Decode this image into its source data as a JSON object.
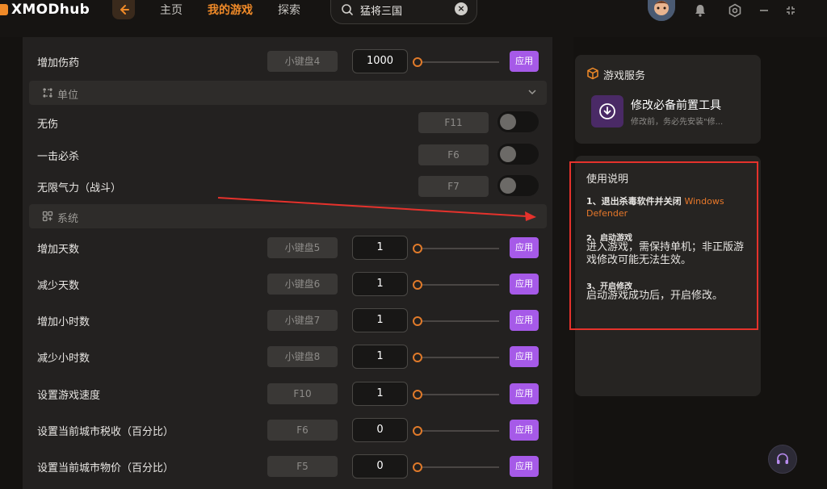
{
  "app": {
    "name": "XMODhub"
  },
  "nav": {
    "home": "主页",
    "my_games": "我的游戏",
    "explore": "探索"
  },
  "search": {
    "value": "猛将三国"
  },
  "colors": {
    "accent": "#f08a28",
    "apply": "#a65ae8",
    "annotation": "#e5322c"
  },
  "mods": {
    "top_row": {
      "label": "增加伤药",
      "key": "小键盘4",
      "value": "1000",
      "apply": "应用"
    },
    "section_unit": {
      "label": "单位"
    },
    "unit_rows": [
      {
        "label": "无伤",
        "key": "F11"
      },
      {
        "label": "一击必杀",
        "key": "F6"
      },
      {
        "label": "无限气力（战斗）",
        "key": "F7"
      }
    ],
    "section_system": {
      "label": "系统"
    },
    "system_rows": [
      {
        "label": "增加天数",
        "key": "小键盘5",
        "value": "1",
        "apply": "应用"
      },
      {
        "label": "减少天数",
        "key": "小键盘6",
        "value": "1",
        "apply": "应用"
      },
      {
        "label": "增加小时数",
        "key": "小键盘7",
        "value": "1",
        "apply": "应用"
      },
      {
        "label": "减少小时数",
        "key": "小键盘8",
        "value": "1",
        "apply": "应用"
      },
      {
        "label": "设置游戏速度",
        "key": "F10",
        "value": "1",
        "apply": "应用"
      },
      {
        "label": "设置当前城市税收（百分比）",
        "key": "F6",
        "value": "0",
        "apply": "应用"
      },
      {
        "label": "设置当前城市物价（百分比）",
        "key": "F5",
        "value": "0",
        "apply": "应用"
      }
    ]
  },
  "service": {
    "title": "游戏服务",
    "tool_name": "修改必备前置工具",
    "tool_desc": "修改前，务必先安装\"修..."
  },
  "usage": {
    "title": "使用说明",
    "step1_prefix": "1、退出杀毒软件并关闭 ",
    "step1_highlight": "Windows Defender",
    "step2_title": "2、启动游戏",
    "step2_body": "进入游戏，需保持单机；非正版游戏修改可能无法生效。",
    "step3_title": "3、开启修改",
    "step3_body": "启动游戏成功后，开启修改。"
  },
  "icons": {
    "back": "arrow-left-icon",
    "search": "search-icon",
    "clear": "clear-icon",
    "bell": "bell-icon",
    "settings": "settings-icon",
    "minimize": "minimize-icon",
    "fullscreen": "fullscreen-icon",
    "service": "cube-icon",
    "download": "download-icon",
    "support": "headset-icon"
  }
}
